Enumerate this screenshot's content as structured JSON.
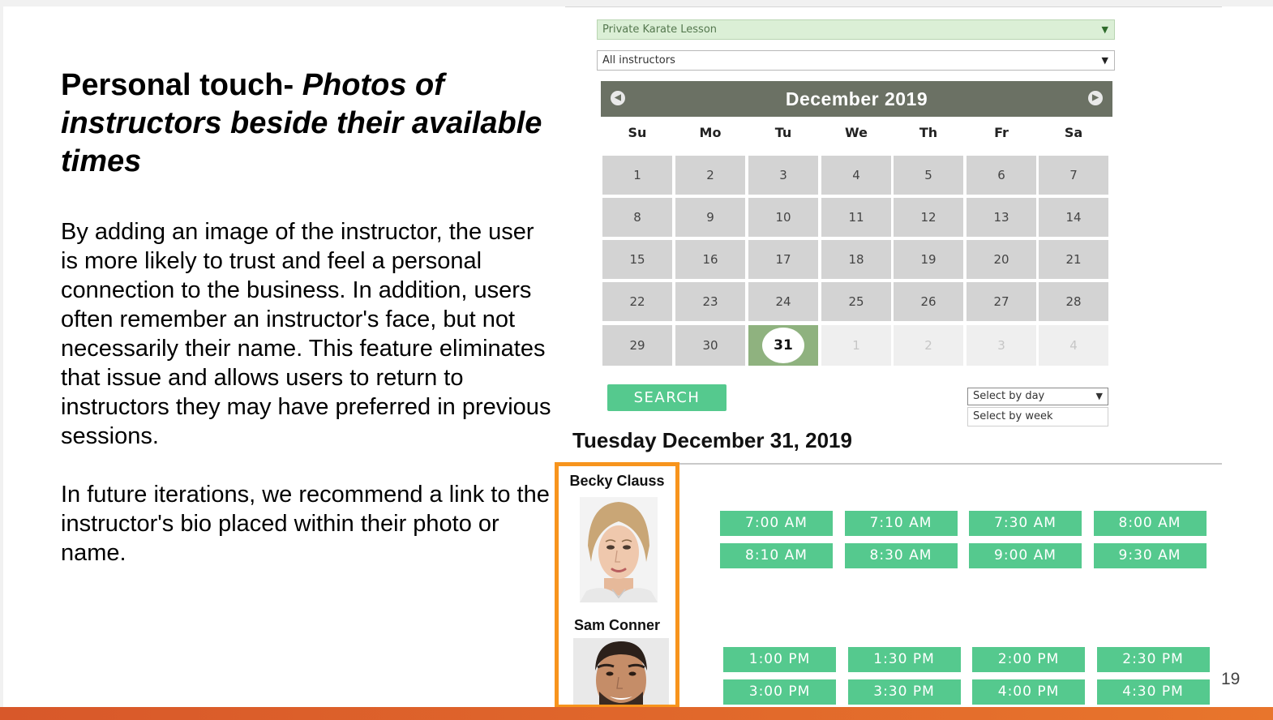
{
  "slide": {
    "title_plain": "Personal touch-",
    "title_italic": " Photos of instructors beside their available times",
    "paragraph1": "By adding an image of the instructor, the user is more likely to trust and feel a personal connection to the business. In addition, users often remember an instructor's face, but not necessarily their name.  This feature eliminates that issue and allows users to return to instructors they may have preferred in previous sessions.",
    "paragraph2": "In future iterations, we recommend a link to the instructor's bio placed within their photo or name.",
    "page_number": "19",
    "accent_color": "#e8752c"
  },
  "booking": {
    "lesson_select": "Private Karate Lesson",
    "instructor_select": "All instructors",
    "calendar": {
      "month_title": "December 2019",
      "prev_icon": "chevron-left-icon",
      "next_icon": "chevron-right-icon",
      "weekdays": [
        "Su",
        "Mo",
        "Tu",
        "We",
        "Th",
        "Fr",
        "Sa"
      ],
      "days": [
        "1",
        "2",
        "3",
        "4",
        "5",
        "6",
        "7",
        "8",
        "9",
        "10",
        "11",
        "12",
        "13",
        "14",
        "15",
        "16",
        "17",
        "18",
        "19",
        "20",
        "21",
        "22",
        "23",
        "24",
        "25",
        "26",
        "27",
        "28",
        "29",
        "30",
        "31"
      ],
      "next_month_days": [
        "1",
        "2",
        "3",
        "4"
      ],
      "selected_day": "31",
      "selected_color": "#8fb27f"
    },
    "search_label": "SEARCH",
    "view_select": "Select by day",
    "view_option": "Select by week",
    "date_heading": "Tuesday December 31, 2019",
    "slot_color": "#55c98e",
    "instructors": [
      {
        "name": "Becky Clauss",
        "slots": [
          "7:00 AM",
          "7:10 AM",
          "7:30 AM",
          "8:00 AM",
          "8:10 AM",
          "8:30 AM",
          "9:00 AM",
          "9:30 AM"
        ]
      },
      {
        "name": "Sam Conner",
        "slots": [
          "1:00 PM",
          "1:30 PM",
          "2:00 PM",
          "2:30 PM",
          "3:00 PM",
          "3:30 PM",
          "4:00 PM",
          "4:30 PM"
        ]
      }
    ]
  }
}
